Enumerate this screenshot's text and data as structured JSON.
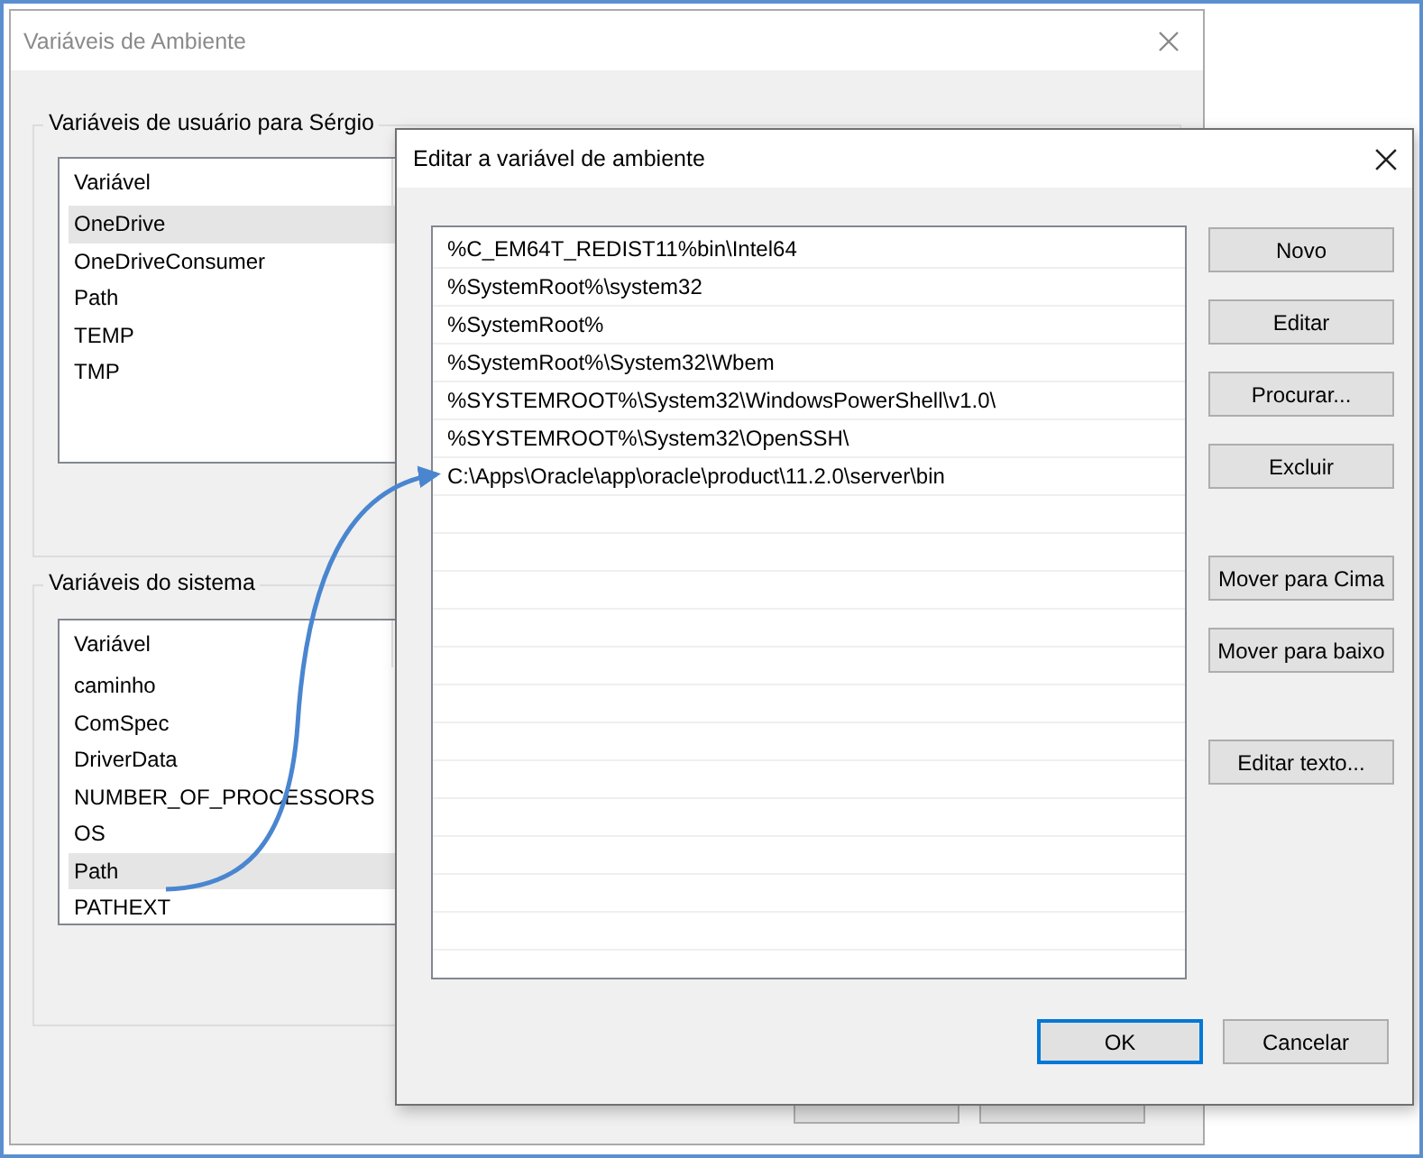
{
  "background_window": {
    "title": "Variáveis de Ambiente",
    "groups": [
      {
        "title": "Variáveis de usuário para Sérgio",
        "column": "Variável",
        "rows": [
          {
            "name": "OneDrive",
            "selected": true
          },
          {
            "name": "OneDriveConsumer",
            "selected": false
          },
          {
            "name": "Path",
            "selected": false
          },
          {
            "name": "TEMP",
            "selected": false
          },
          {
            "name": "TMP",
            "selected": false
          }
        ]
      },
      {
        "title": "Variáveis do sistema",
        "column": "Variável",
        "rows": [
          {
            "name": "caminho",
            "selected": false
          },
          {
            "name": "ComSpec",
            "selected": false
          },
          {
            "name": "DriverData",
            "selected": false
          },
          {
            "name": "NUMBER_OF_PROCESSORS",
            "selected": false
          },
          {
            "name": "OS",
            "selected": false
          },
          {
            "name": "Path",
            "selected": true
          },
          {
            "name": "PATHEXT",
            "selected": false
          }
        ]
      }
    ]
  },
  "edit_dialog": {
    "title": "Editar a variável de ambiente",
    "entries": [
      "%C_EM64T_REDIST11%bin\\Intel64",
      "%SystemRoot%\\system32",
      "%SystemRoot%",
      "%SystemRoot%\\System32\\Wbem",
      "%SYSTEMROOT%\\System32\\WindowsPowerShell\\v1.0\\",
      "%SYSTEMROOT%\\System32\\OpenSSH\\",
      "C:\\Apps\\Oracle\\app\\oracle\\product\\11.2.0\\server\\bin"
    ],
    "side_button_groups": [
      {
        "buttons": [
          "Novo",
          "Editar",
          "Procurar...",
          "Excluir"
        ]
      },
      {
        "buttons": [
          "Mover para Cima",
          "Mover para baixo"
        ]
      },
      {
        "buttons": [
          "Editar texto..."
        ]
      }
    ],
    "footer_buttons": [
      {
        "label": "OK",
        "default": true
      },
      {
        "label": "Cancelar",
        "default": false
      }
    ]
  }
}
